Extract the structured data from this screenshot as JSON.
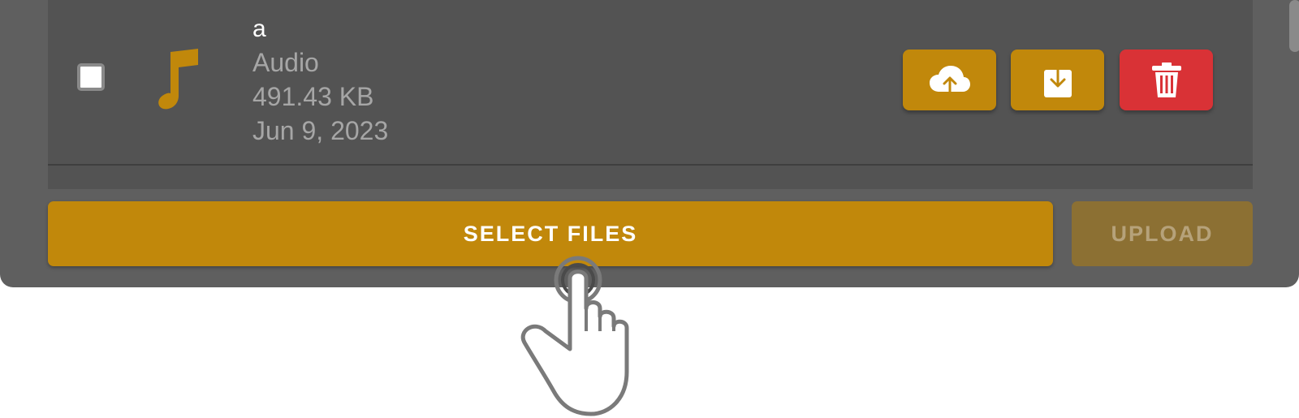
{
  "file_list": {
    "items": [
      {
        "name": "a",
        "type": "Audio",
        "size": "491.43 KB",
        "date": "Jun 9, 2023",
        "icon": "music-note-icon"
      }
    ]
  },
  "actions": {
    "upload_cloud_icon": "cloud-upload-icon",
    "download_icon": "download-icon",
    "delete_icon": "trash-icon"
  },
  "footer": {
    "select_files_label": "SELECT FILES",
    "upload_label": "UPLOAD"
  },
  "colors": {
    "accent": "#c1880b",
    "danger": "#d93236",
    "disabled": "#8c7033",
    "panel": "#5f5f5f",
    "list_bg": "#535353"
  },
  "cursor": {
    "icon": "hand-pointer-icon"
  }
}
